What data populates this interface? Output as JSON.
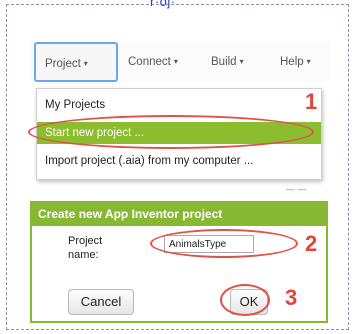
{
  "header_fragment": "r·oj·",
  "menubar": {
    "items": [
      {
        "label": "Project",
        "caret": "▾"
      },
      {
        "label": "Connect",
        "caret": "▾"
      },
      {
        "label": "Build",
        "caret": "▾"
      },
      {
        "label": "Help",
        "caret": "▾"
      }
    ]
  },
  "project_menu": {
    "items": [
      {
        "label": "My Projects"
      },
      {
        "label": "Start new project ..."
      },
      {
        "label": "Import project (.aia) from my computer ..."
      }
    ]
  },
  "peek_text": "— —",
  "dialog": {
    "title": "Create new App Inventor project",
    "name_label": "Project name:",
    "name_value": "AnimalsType",
    "cancel_label": "Cancel",
    "ok_label": "OK"
  },
  "steps": [
    "1",
    "2",
    "3"
  ],
  "colors": {
    "menu_highlight": "#8cbd2f",
    "dialog_accent": "#86b832",
    "annotation": "#e3453b",
    "focus_border": "#6aa8e8"
  }
}
